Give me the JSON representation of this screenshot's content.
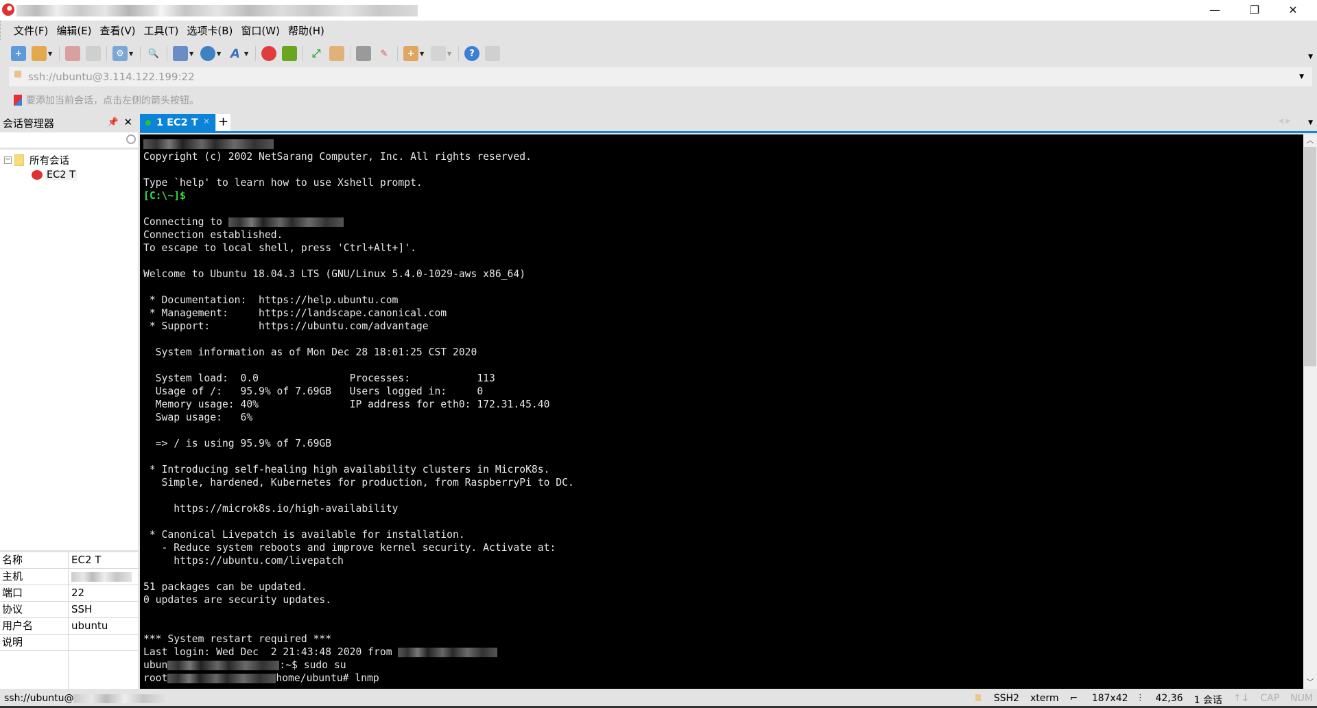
{
  "window": {
    "title": "",
    "minimize": "—",
    "restore": "❐",
    "close": "✕"
  },
  "menu": [
    "文件(F)",
    "编辑(E)",
    "查看(V)",
    "工具(T)",
    "选项卡(B)",
    "窗口(W)",
    "帮助(H)"
  ],
  "toolbar": {
    "icons": [
      "new-session-icon",
      "open-folder-icon",
      "disconnect-icon",
      "reconnect-icon",
      "session-properties-icon",
      "find-icon",
      "transfer-icon",
      "globe-icon",
      "font-icon",
      "xshell-logo-icon",
      "xftp-icon",
      "fullscreen-icon",
      "lock-icon",
      "keyboard-icon",
      "highlight-icon",
      "new-folder-icon",
      "layout-icon",
      "help-icon",
      "chat-icon"
    ]
  },
  "address": {
    "value": "ssh://ubuntu@3.114.122.199:22"
  },
  "links_bar": {
    "hint": "要添加当前会话，点击左侧的箭头按钮。"
  },
  "session_manager": {
    "title": "会话管理器",
    "search_placeholder": "",
    "tree": {
      "root": "所有会话",
      "children": [
        "EC2 T"
      ]
    },
    "properties": [
      {
        "key": "名称",
        "value": "EC2 T"
      },
      {
        "key": "主机",
        "value": ""
      },
      {
        "key": "端口",
        "value": "22"
      },
      {
        "key": "协议",
        "value": "SSH"
      },
      {
        "key": "用户名",
        "value": "ubuntu"
      },
      {
        "key": "说明",
        "value": ""
      }
    ]
  },
  "tabs": [
    {
      "label": "1 EC2 T",
      "active": true,
      "status": "connected"
    }
  ],
  "terminal": {
    "lines": [
      "",
      "Copyright (c) 2002 NetSarang Computer, Inc. All rights reserved.",
      "",
      "Type `help' to learn how to use Xshell prompt.",
      "[C:\\~]$",
      "",
      "Connecting to ",
      "Connection established.",
      "To escape to local shell, press 'Ctrl+Alt+]'.",
      "",
      "Welcome to Ubuntu 18.04.3 LTS (GNU/Linux 5.4.0-1029-aws x86_64)",
      "",
      " * Documentation:  https://help.ubuntu.com",
      " * Management:     https://landscape.canonical.com",
      " * Support:        https://ubuntu.com/advantage",
      "",
      "  System information as of Mon Dec 28 18:01:25 CST 2020",
      "",
      "  System load:  0.0               Processes:           113",
      "  Usage of /:   95.9% of 7.69GB   Users logged in:     0",
      "  Memory usage: 40%               IP address for eth0: 172.31.45.40",
      "  Swap usage:   6%",
      "",
      "  => / is using 95.9% of 7.69GB",
      "",
      " * Introducing self-healing high availability clusters in MicroK8s.",
      "   Simple, hardened, Kubernetes for production, from RaspberryPi to DC.",
      "",
      "     https://microk8s.io/high-availability",
      "",
      " * Canonical Livepatch is available for installation.",
      "   - Reduce system reboots and improve kernel security. Activate at:",
      "     https://ubuntu.com/livepatch",
      "",
      "51 packages can be updated.",
      "0 updates are security updates.",
      "",
      "",
      "*** System restart required ***",
      "Last login: Wed Dec  2 21:43:48 2020 from ",
      "ubun",
      "root"
    ],
    "line_suffix_39": "",
    "prompt_user_suffix": ":~$ sudo su",
    "prompt_root_suffix": "home/ubuntu# lnmp"
  },
  "statusbar": {
    "left": "ssh://ubuntu@",
    "protocol": "SSH2",
    "terminal_type": "xterm",
    "size": "187x42",
    "cursor": "42,36",
    "sessions": "1 会话",
    "cap": "CAP",
    "num": "NUM"
  },
  "colors": {
    "tab_active": "#0a83d8",
    "prompt_green": "#35e04a",
    "terminal_bg": "#000000"
  }
}
